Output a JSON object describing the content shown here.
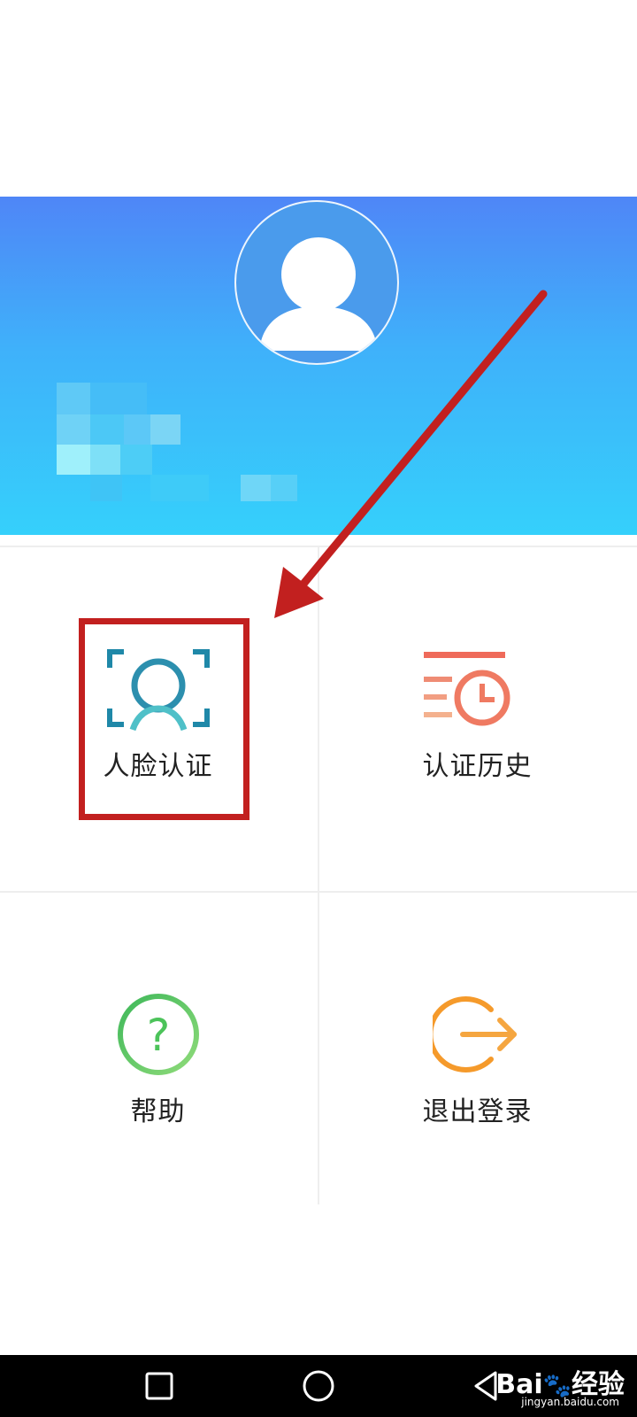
{
  "menu": {
    "face_auth_label": "人脸认证",
    "history_label": "认证历史",
    "help_label": "帮助",
    "logout_label": "退出登录",
    "help_glyph": "?"
  },
  "icons": {
    "avatar": "user-avatar-icon",
    "face_auth": "face-scan-icon",
    "history": "history-clock-icon",
    "help": "help-circle-icon",
    "logout": "logout-icon",
    "nav_recent": "square-icon",
    "nav_home": "circle-icon",
    "nav_back": "triangle-back-icon"
  },
  "colors": {
    "header_top": "#4f86f7",
    "header_bottom": "#35d0fb",
    "face_icon": "#1f88a8",
    "history_icon": "#ef6a5a",
    "help_icon": "#4cc35a",
    "logout_icon": "#f59a2b",
    "annotation": "#c2201f"
  },
  "watermark": {
    "brand": "Bai",
    "suffix": "经验",
    "url": "jingyan.baidu.com"
  }
}
